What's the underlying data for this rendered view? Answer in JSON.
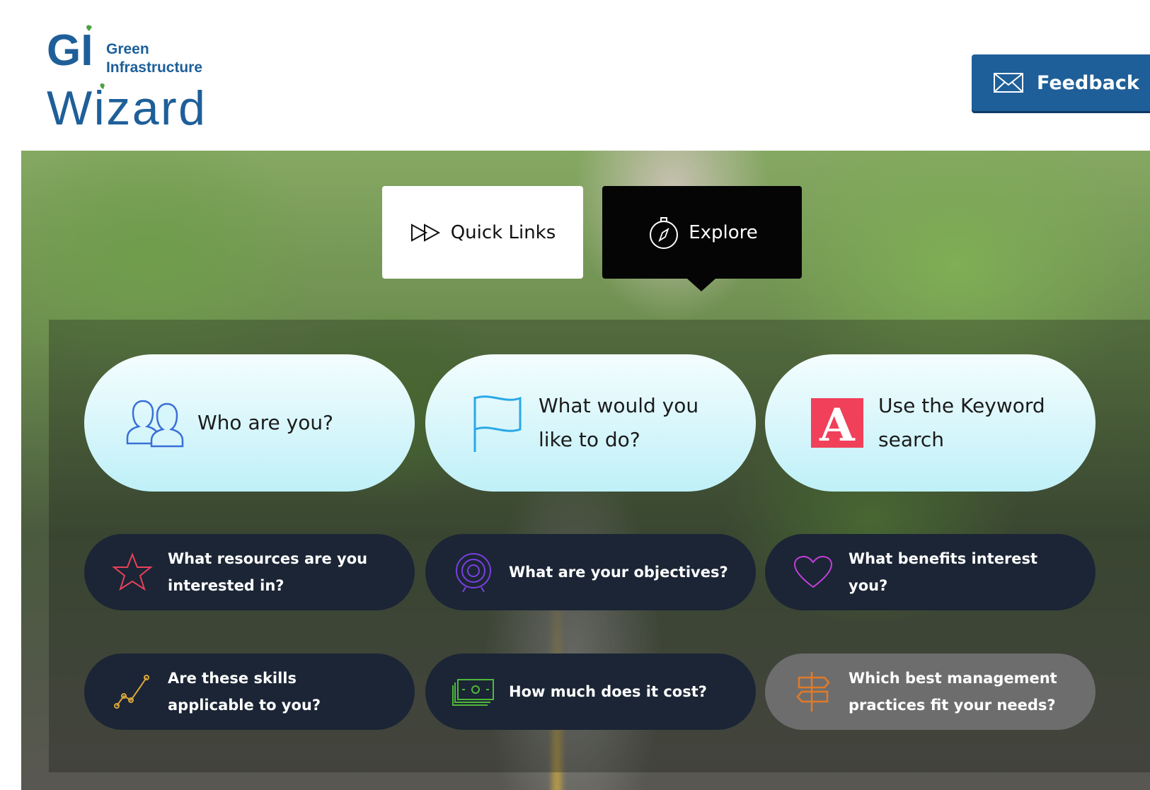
{
  "header": {
    "logo": {
      "gi": "GI",
      "line1": "Green",
      "line2": "Infrastructure",
      "word": "Wizard"
    },
    "feedback_label": "Feedback",
    "feedback_icon": "envelope-icon"
  },
  "tabs": [
    {
      "label": "Quick Links",
      "icon": "fast-forward-icon",
      "selected": false
    },
    {
      "label": "Explore",
      "icon": "compass-icon",
      "selected": true
    }
  ],
  "explore": {
    "big": [
      {
        "label": "Who are you?",
        "icon": "users-icon"
      },
      {
        "label": "What would you like to do?",
        "icon": "flag-icon"
      },
      {
        "label": "Use the Keyword search",
        "icon": "letter-a-icon"
      }
    ],
    "small": [
      {
        "label": "What resources are you interested in?",
        "icon": "star-icon"
      },
      {
        "label": "What are your objectives?",
        "icon": "target-icon"
      },
      {
        "label": "What benefits interest you?",
        "icon": "heart-icon"
      },
      {
        "label": "Are these skills applicable to you?",
        "icon": "chart-line-icon"
      },
      {
        "label": "How much does it cost?",
        "icon": "money-icon"
      },
      {
        "label": "Which best management practices fit your needs?",
        "icon": "signpost-icon"
      }
    ]
  },
  "colors": {
    "brand_blue": "#1e5f99",
    "pill_dark": "#1b2535",
    "pill_gray": "#6d6d6d",
    "keyword_red": "#f0405a"
  }
}
